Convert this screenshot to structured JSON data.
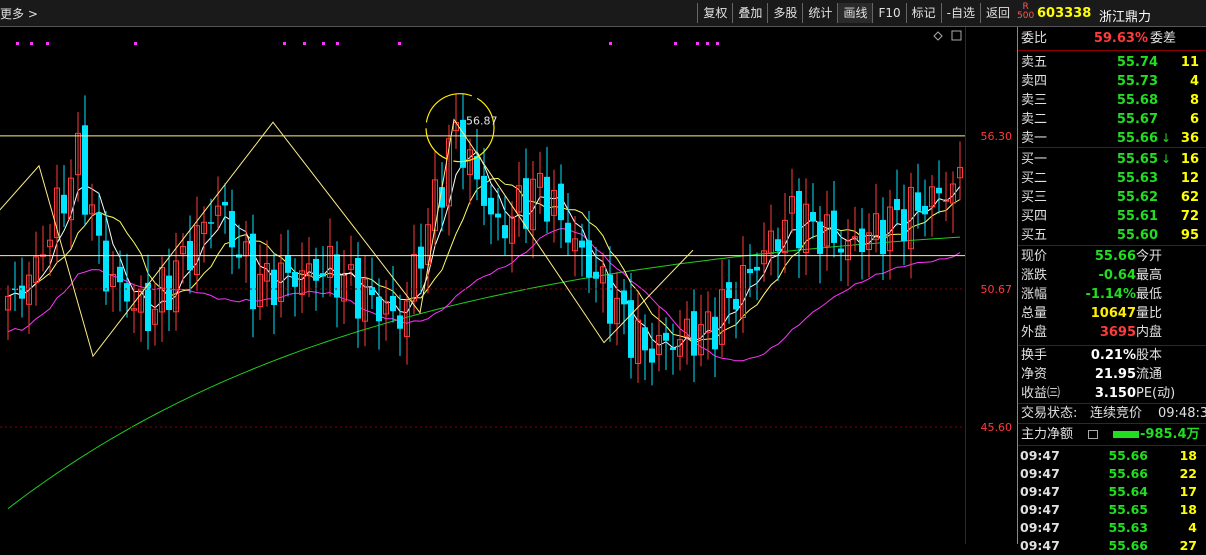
{
  "toolbar": {
    "more_label": "更多 >",
    "buttons": [
      "复权",
      "叠加",
      "多股",
      "统计",
      "画线",
      "F10",
      "标记",
      "-自选",
      "返回"
    ],
    "selected": "画线"
  },
  "stock": {
    "r_badge": "R",
    "r_sub": "500",
    "code": "603338",
    "name": "浙江鼎力"
  },
  "chart_data": {
    "type": "candlestick",
    "price_axis_labels": [
      "56.30",
      "50.67",
      "45.60"
    ],
    "price_range": [
      41.3,
      60.3
    ],
    "high_marker": "56.87",
    "level_lines": [
      56.3,
      51.9
    ],
    "colors": {
      "up": "#ff3b3b",
      "down": "#00e5ff",
      "ma5": "#ffffff",
      "ma10": "#ffff66",
      "ma20": "#ff33ff",
      "ma60": "#22cc22",
      "zigzag": "#ffee88"
    },
    "zigzag_points": [
      [
        -2,
        53.5
      ],
      [
        39,
        55.2
      ],
      [
        93,
        48.2
      ],
      [
        273,
        56.8
      ],
      [
        420,
        49.8
      ],
      [
        454,
        56.9
      ],
      [
        604,
        48.7
      ],
      [
        693,
        52.1
      ]
    ]
  },
  "orderbook": {
    "ratio_label": "委比",
    "ratio_value": "59.63%",
    "diff_label": "委差",
    "asks": [
      {
        "label": "卖五",
        "price": "55.74",
        "vol": "11"
      },
      {
        "label": "卖四",
        "price": "55.73",
        "vol": "4"
      },
      {
        "label": "卖三",
        "price": "55.68",
        "vol": "8"
      },
      {
        "label": "卖二",
        "price": "55.67",
        "vol": "6"
      },
      {
        "label": "卖一",
        "price": "55.66",
        "vol": "36",
        "arrow": "↓"
      }
    ],
    "bids": [
      {
        "label": "买一",
        "price": "55.65",
        "vol": "16",
        "arrow": "↓"
      },
      {
        "label": "买二",
        "price": "55.63",
        "vol": "12"
      },
      {
        "label": "买三",
        "price": "55.62",
        "vol": "62"
      },
      {
        "label": "买四",
        "price": "55.61",
        "vol": "72"
      },
      {
        "label": "买五",
        "price": "55.60",
        "vol": "95"
      }
    ]
  },
  "quote": {
    "rows": [
      {
        "l1": "现价",
        "v1": "55.66",
        "l2": "今开",
        "c": "green"
      },
      {
        "l1": "涨跌",
        "v1": "-0.64",
        "l2": "最高",
        "c": "green"
      },
      {
        "l1": "涨幅",
        "v1": "-1.14%",
        "l2": "最低",
        "c": "green"
      },
      {
        "l1": "总量",
        "v1": "10647",
        "l2": "量比",
        "c": "yellow"
      },
      {
        "l1": "外盘",
        "v1": "3695",
        "l2": "内盘",
        "c": "red"
      }
    ],
    "rows2": [
      {
        "l1": "换手",
        "v1": "0.21%",
        "l2": "股本",
        "c": "white"
      },
      {
        "l1": "净资",
        "v1": "21.95",
        "l2": "流通",
        "c": "white"
      },
      {
        "l1": "收益㈢",
        "v1": "3.150",
        "l2": "PE(动)",
        "c": "white"
      }
    ]
  },
  "status": {
    "label": "交易状态:",
    "value": "连续竞价",
    "time": "09:48:3"
  },
  "mainforce": {
    "label": "主力净额",
    "value": "-985.4万"
  },
  "ticks": [
    {
      "time": "09:47",
      "price": "55.66",
      "vol": "18"
    },
    {
      "time": "09:47",
      "price": "55.66",
      "vol": "22"
    },
    {
      "time": "09:47",
      "price": "55.64",
      "vol": "17"
    },
    {
      "time": "09:47",
      "price": "55.65",
      "vol": "18"
    },
    {
      "time": "09:47",
      "price": "55.63",
      "vol": "4"
    },
    {
      "time": "09:47",
      "price": "55.66",
      "vol": "27"
    }
  ]
}
